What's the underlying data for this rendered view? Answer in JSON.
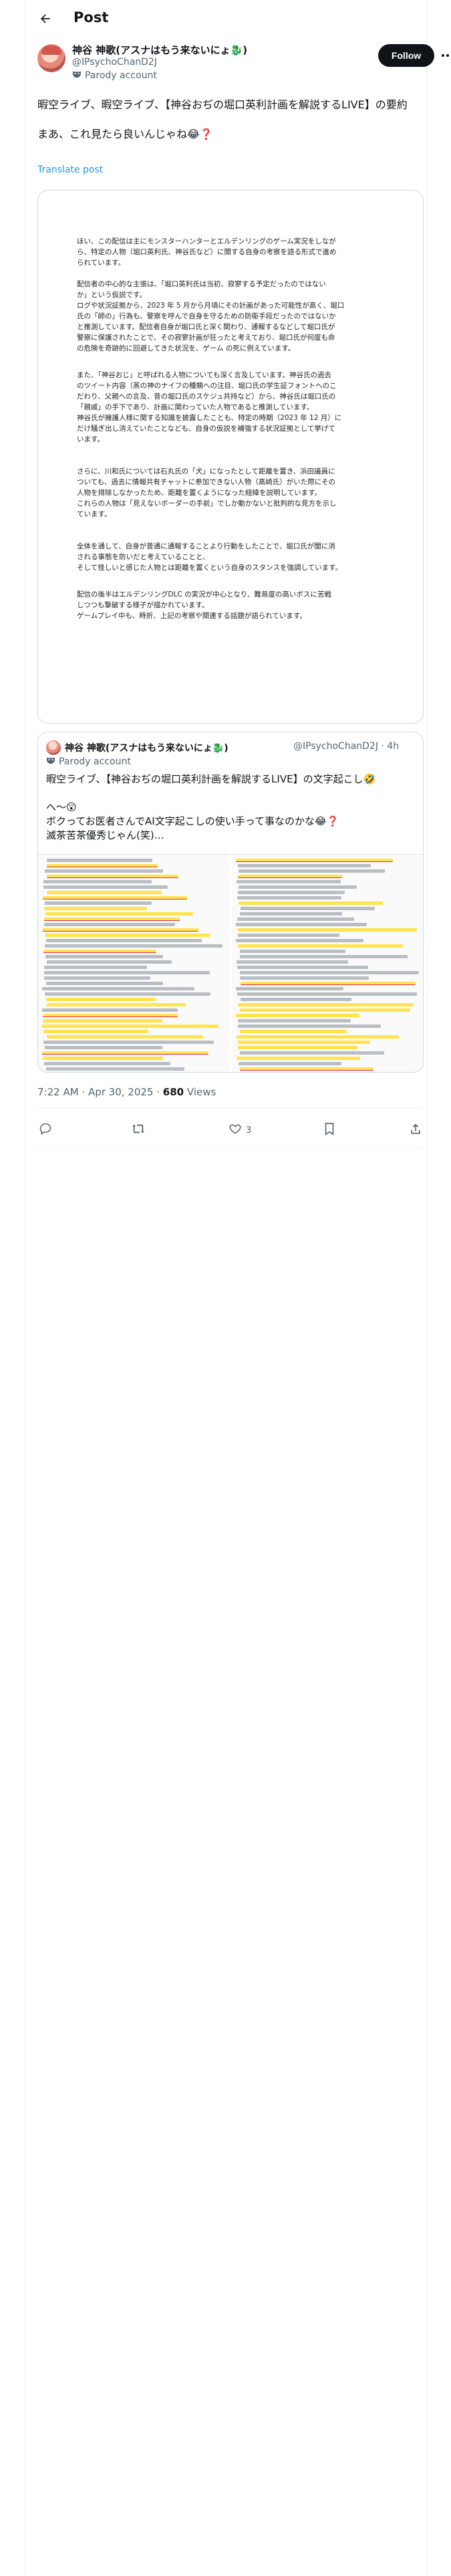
{
  "header": {
    "title": "Post"
  },
  "author": {
    "name": "神谷 神歌(アスナはもう来ないにょ🐉)",
    "handle": "@IPsychoChanD2J",
    "parody_label": "Parody account",
    "follow_label": "Follow"
  },
  "post": {
    "text": "暇空ライブ、暇空ライブ、【神谷おぢの堀口英利計画を解説するLIVE】の要約\n\nまあ、これ見たら良いんじゃね😂❓",
    "translate_label": "Translate post"
  },
  "document": {
    "paragraphs": [
      "ほい、この配信は主にモンスターハンターとエルデンリングのゲーム実況をしなが\nら、特定の人物（堀口英利氏、神谷氏など）に関する自身の考察を語る形式で進め\nられています。",
      "配信者の中心的な主張は、「堀口英利氏は当初、寂寥する予定だったのではない\nか」という仮説です。\nログや状況証拠から、2023 年 5 月から月頃にその計画があった可能性が高く、堀口\n氏の「師の」行為も、警察を呼んで自身を守るための防衛手段だったのではないか\nと推測しています。配信者自身が堀口氏と深く関わり、通報するなどして堀口氏が\n警察に保護されたことで、その寂寥計画が狂ったと考えており、堀口氏が何度も命\nの危険を奇跡的に回避してきた状況を、ゲーム の死に例えています。",
      "また、「神谷おじ」と呼ばれる人物についても深く言及しています。神谷氏の過去\nのツイート内容（蒸の神のナイフの種類への注目、堀口氏の学生証フォントへのこ\nだわり、父親への言及、昔の堀口氏のスケジュ共持など）から、神谷氏は堀口氏の\n「親戚」の手下であり、計画に関わっていた人物であると推測しています。\n神谷氏が擁護人様に関する知識を披露したことも、特定の時期（2023 年 12 月）に\nだけ騒ぎ出し消えていたことなども、自身の仮説を補強する状況証拠として挙げて\nいます。",
      "さらに、川和氏については石丸氏の「犬」になったとして距離を置き、浜田議員に\nついても、過去に情報共有チャットに参加できない人物（高崎氏）がいた際にその\n人物を排除しなかったため、距離を置くようになった経緯を説明しています。\nこれらの人物は「見えないボーダーの手前」でしか動かないと批判的な見方を示し\nています。",
      "全体を通して、自身が普通に通報することより行動をしたことで、堀口氏が闇に消\nされる事態を防いだと考えていることと、\nそして怪しいと感じた人物とは距離を置くという自身のスタンスを強調しています。",
      "配信の後半はエルデンリングDLC の実況が中心となり、難易度の高いボスに苦戦\nしつつも撃破する様子が描かれています。\nゲームプレイ中も、時折、上記の考察や関連する話題が語られています。"
    ]
  },
  "quote": {
    "name": "神谷 神歌(アスナはもう来ないにょ🐉)",
    "handle": "@IPsychoChanD2J · 4h",
    "parody_label": "Parody account",
    "text": "暇空ライブ、【神谷おぢの堀口英利計画を解説するLIVE】の文字起こし🤣\n\nへ～😲\nボクってお医者さんでAI文字起こしの使い手って事なのかな😂❓\n滅茶苦茶優秀じゃん(笑)…"
  },
  "meta": {
    "time": "7:22 AM · Apr 30, 2025 · ",
    "views_count": "680",
    "views_label": " Views"
  },
  "actions": {
    "like_count": "3"
  },
  "colors": {
    "accent": "#1d9bf0",
    "highlight": "#ffe44d",
    "highlight_red": "#e0245e"
  }
}
